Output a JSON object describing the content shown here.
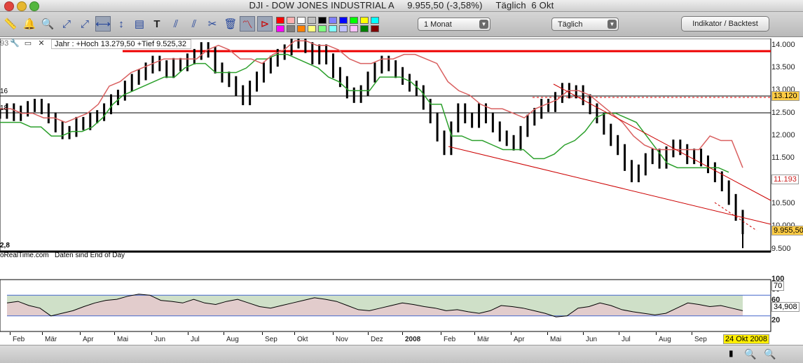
{
  "window": {
    "title": "DJI - DOW JONES INDUSTRIAL A     9.955,50 (-3,58%)     Täglich  6 Okt"
  },
  "toolbar": {
    "period_select": "1 Monat",
    "interval_select": "Täglich",
    "indicator_button": "Indikator / Backtest",
    "tools": [
      "ruler-icon",
      "bell-icon",
      "zoom-icon",
      "line-tool-icon",
      "trend-line-icon",
      "horizontal-line-icon",
      "vertical-line-icon",
      "fibonacci-icon",
      "text-icon",
      "parallel-line-icon",
      "tools-icon",
      "trash-icon",
      "chart-style-icon",
      "triangle-tool-icon"
    ],
    "colors": [
      "#ff0000",
      "#ffb0b0",
      "#ffffff",
      "#c0c0c0",
      "#000000",
      "#8080ff",
      "#0000ff",
      "#00ff00",
      "#ffff00",
      "#00ffff",
      "#ff00ff",
      "#808080",
      "#ff8000",
      "#ffff80",
      "#80ff80",
      "#80ffff",
      "#c0c0ff",
      "#ffc0ff",
      "#008000",
      "#800000"
    ]
  },
  "info": {
    "left_fragment": "93",
    "period_text": "Jahr : +Hoch 13.279,50 +Tief 9.525,32",
    "left_labels": [
      "16",
      "18",
      "2,8"
    ],
    "footer": "oRealTime.com   Daten sind End of Day"
  },
  "y_axis": [
    "14.000",
    "13.500",
    "13.000",
    "12.500",
    "12.000",
    "11.500",
    "11.000",
    "10.500",
    "10.000",
    "9.500"
  ],
  "price_tags": {
    "upper": "13.120",
    "mid": "11.193",
    "last": "9.955,50"
  },
  "rsi_axis": [
    "100",
    "80",
    "60",
    "40",
    "20"
  ],
  "rsi_tags": {
    "upper": "70",
    "value": "34,908"
  },
  "x_axis": [
    "Feb",
    "Mär",
    "Apr",
    "Mai",
    "Jun",
    "Jul",
    "Aug",
    "Sep",
    "Okt",
    "Nov",
    "Dez",
    "2008",
    "Feb",
    "Mär",
    "Apr",
    "Mai",
    "Jun",
    "Jul",
    "Aug",
    "Sep"
  ],
  "date_tag": "24 Okt 2008",
  "chart_data": {
    "type": "line",
    "instrument": "DJI",
    "ylim": [
      9450,
      14150
    ],
    "price": [
      12500,
      12600,
      12450,
      12550,
      12650,
      12700,
      12600,
      12400,
      12200,
      12050,
      12100,
      12300,
      12250,
      12400,
      12450,
      12600,
      12800,
      12900,
      13100,
      13250,
      13350,
      13500,
      13650,
      13550,
      13400,
      13600,
      13550,
      13700,
      13800,
      13950,
      13850,
      13500,
      13300,
      13200,
      13000,
      12800,
      13100,
      13300,
      13500,
      13650,
      13800,
      13900,
      14050,
      14100,
      13950,
      13700,
      13900,
      13700,
      13400,
      13200,
      12950,
      12850,
      13000,
      13300,
      13500,
      13650,
      13550,
      13400,
      13250,
      13100,
      13000,
      12700,
      12400,
      12000,
      11700,
      12200,
      12600,
      12400,
      12300,
      12600,
      12400,
      12200,
      12000,
      11900,
      11800,
      12100,
      12350,
      12500,
      12700,
      12650,
      12850,
      13050,
      12950,
      13000,
      12800,
      12600,
      12400,
      12150,
      11900,
      11700,
      11350,
      11100,
      11250,
      11500,
      11600,
      11400,
      11650,
      11800,
      11700,
      11500,
      11600,
      11450,
      11300,
      11100,
      10900,
      10600,
      10250,
      9955
    ],
    "support_line": [
      12300,
      12300,
      12300,
      12200,
      12200,
      12000,
      12000,
      12100,
      12100,
      12200,
      12400,
      12700,
      12900,
      13000,
      13100,
      13200,
      13300,
      13300,
      13500,
      13600,
      13600,
      13400,
      13400,
      13400,
      13500,
      13700,
      13700,
      13800,
      13800,
      13700,
      13600,
      13500,
      13300,
      13200,
      13000,
      13000,
      13000,
      13300,
      13300,
      13300,
      13200,
      13000,
      12700,
      12700,
      12000,
      12000,
      11900,
      11900,
      11800,
      11700,
      11700,
      11700,
      11500,
      11500,
      11600,
      11800,
      11900,
      12100,
      12400,
      12500,
      12500,
      12400,
      12300,
      12000,
      11700,
      11400,
      11300,
      11300,
      11300,
      11300,
      11300,
      11200
    ],
    "resistance_line": [
      12600,
      12600,
      12500,
      12500,
      12400,
      12400,
      12300,
      12400,
      12500,
      12700,
      13100,
      13200,
      13400,
      13500,
      13600,
      13700,
      13700,
      13700,
      13700,
      13900,
      14000,
      13900,
      13700,
      13700,
      13600,
      13800,
      13900,
      14100,
      14100,
      14000,
      14000,
      13900,
      13700,
      13600,
      13600,
      13700,
      13700,
      13800,
      13800,
      13700,
      13600,
      13200,
      13000,
      12900,
      12700,
      12600,
      12600,
      12500,
      12400,
      12600,
      12700,
      12800,
      13000,
      13000,
      12900,
      12700,
      12500,
      12300,
      12000,
      11800,
      11700,
      11700,
      11700,
      11700,
      11700,
      12000,
      11900,
      11900,
      11300
    ],
    "rsi": [
      55,
      58,
      50,
      45,
      30,
      35,
      40,
      48,
      55,
      60,
      62,
      68,
      72,
      70,
      60,
      58,
      55,
      62,
      55,
      52,
      58,
      62,
      55,
      48,
      45,
      50,
      55,
      60,
      65,
      62,
      58,
      50,
      42,
      40,
      45,
      50,
      55,
      52,
      48,
      45,
      40,
      42,
      38,
      35,
      40,
      50,
      48,
      45,
      40,
      35,
      28,
      30,
      45,
      48,
      55,
      50,
      42,
      38,
      35,
      32,
      35,
      45,
      55,
      52,
      48,
      50,
      45,
      40
    ],
    "rsi_levels": [
      70,
      30
    ],
    "annotations": {
      "year_high": "13.279,50",
      "year_low": "9.525,32"
    }
  }
}
